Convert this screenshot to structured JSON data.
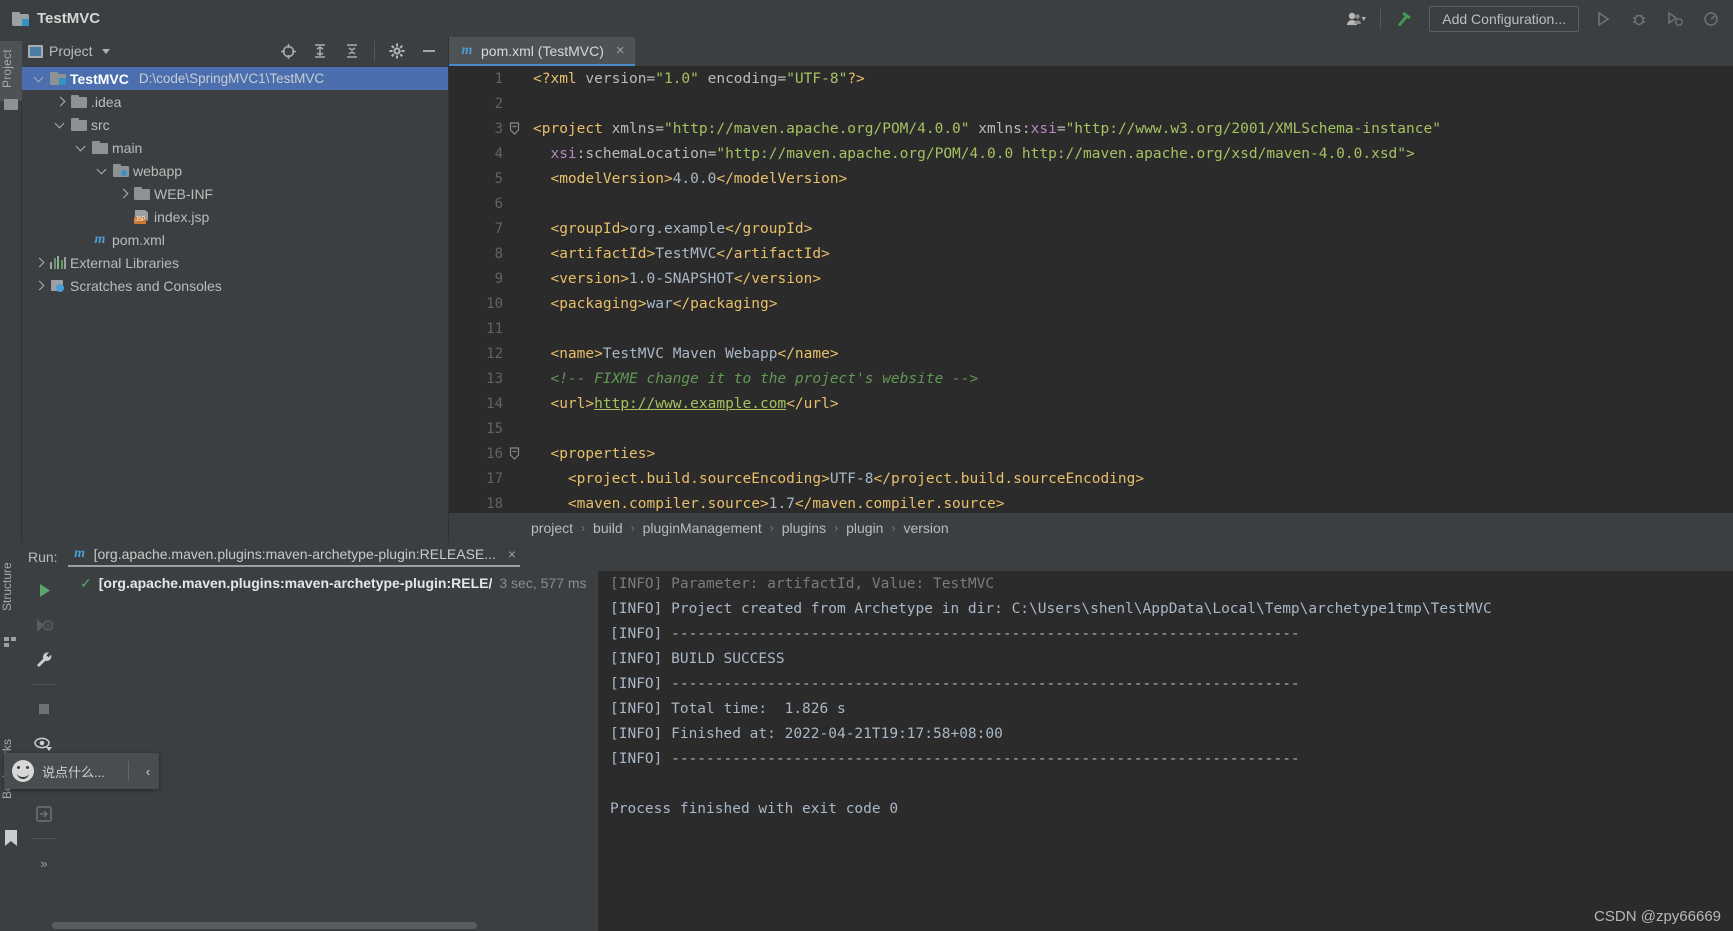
{
  "window": {
    "title": "TestMVC",
    "project_icon": "folder-module-icon"
  },
  "titlebar": {
    "user_icon": "user-account-icon",
    "hammer_icon": "build-hammer-icon",
    "add_configuration": "Add Configuration...",
    "run_icon": "run-icon",
    "debug_icon": "debug-icon",
    "coverage_icon": "run-with-coverage-icon",
    "profile_icon": "profiler-icon"
  },
  "left_strip": {
    "project_tab": "Project",
    "structure_tab": "Structure",
    "bookmarks_tab": "Bookmarks"
  },
  "project_panel": {
    "title": "Project",
    "icons": {
      "locate": "locate-file-icon",
      "expand": "expand-all-icon",
      "collapse": "collapse-all-icon",
      "settings": "gear-icon",
      "hide": "hide-panel-icon",
      "dropdown": "chevron-down-icon"
    },
    "tree": [
      {
        "label": "TestMVC",
        "path": "D:\\code\\SpringMVC1\\TestMVC",
        "indent": 0,
        "icon": "module-folder-icon",
        "state": "expanded",
        "selected": true,
        "bold": true
      },
      {
        "label": ".idea",
        "path": "",
        "indent": 1,
        "icon": "folder-icon",
        "state": "collapsed",
        "selected": false,
        "bold": false
      },
      {
        "label": "src",
        "path": "",
        "indent": 1,
        "icon": "folder-icon",
        "state": "expanded",
        "selected": false,
        "bold": false
      },
      {
        "label": "main",
        "path": "",
        "indent": 2,
        "icon": "folder-icon",
        "state": "expanded",
        "selected": false,
        "bold": false
      },
      {
        "label": "webapp",
        "path": "",
        "indent": 3,
        "icon": "web-folder-icon",
        "state": "expanded",
        "selected": false,
        "bold": false
      },
      {
        "label": "WEB-INF",
        "path": "",
        "indent": 4,
        "icon": "folder-icon",
        "state": "collapsed",
        "selected": false,
        "bold": false
      },
      {
        "label": "index.jsp",
        "path": "",
        "indent": 4,
        "icon": "jsp-file-icon",
        "state": "leaf",
        "selected": false,
        "bold": false
      },
      {
        "label": "pom.xml",
        "path": "",
        "indent": 2,
        "icon": "maven-file-icon",
        "state": "leaf",
        "selected": false,
        "bold": false
      },
      {
        "label": "External Libraries",
        "path": "",
        "indent": 0,
        "icon": "libraries-icon",
        "state": "collapsed",
        "selected": false,
        "bold": false
      },
      {
        "label": "Scratches and Consoles",
        "path": "",
        "indent": 0,
        "icon": "scratches-icon",
        "state": "collapsed",
        "selected": false,
        "bold": false
      }
    ]
  },
  "editor": {
    "tab": {
      "label": "pom.xml (TestMVC)",
      "icon": "maven-file-icon",
      "close": "×"
    },
    "lines": [
      {
        "n": "1",
        "fold": false,
        "tokens": [
          {
            "t": "tag",
            "v": "<?xml "
          },
          {
            "t": "attr",
            "v": "version="
          },
          {
            "t": "val",
            "v": "\"1.0\""
          },
          {
            "t": "attr",
            "v": " encoding="
          },
          {
            "t": "val",
            "v": "\"UTF-8\""
          },
          {
            "t": "tag",
            "v": "?>"
          }
        ]
      },
      {
        "n": "2",
        "fold": false,
        "tokens": []
      },
      {
        "n": "3",
        "fold": true,
        "tokens": [
          {
            "t": "tag",
            "v": "<project "
          },
          {
            "t": "attr",
            "v": "xmlns="
          },
          {
            "t": "val",
            "v": "\"http://maven.apache.org/POM/4.0.0\""
          },
          {
            "t": "attr",
            "v": " xmlns:"
          },
          {
            "t": "ns",
            "v": "xsi"
          },
          {
            "t": "attr",
            "v": "="
          },
          {
            "t": "val",
            "v": "\"http://www.w3.org/2001/XMLSchema-instance\""
          }
        ]
      },
      {
        "n": "4",
        "fold": false,
        "tokens": [
          {
            "t": "txt",
            "v": "  "
          },
          {
            "t": "ns",
            "v": "xsi"
          },
          {
            "t": "attr",
            "v": ":schemaLocation="
          },
          {
            "t": "val",
            "v": "\"http://maven.apache.org/POM/4.0.0 http://maven.apache.org/xsd/maven-4.0.0.xsd\">"
          }
        ]
      },
      {
        "n": "5",
        "fold": false,
        "tokens": [
          {
            "t": "txt",
            "v": "  "
          },
          {
            "t": "tag",
            "v": "<modelVersion>"
          },
          {
            "t": "txt",
            "v": "4.0.0"
          },
          {
            "t": "tag",
            "v": "</modelVersion>"
          }
        ]
      },
      {
        "n": "6",
        "fold": false,
        "tokens": []
      },
      {
        "n": "7",
        "fold": false,
        "tokens": [
          {
            "t": "txt",
            "v": "  "
          },
          {
            "t": "tag",
            "v": "<groupId>"
          },
          {
            "t": "txt",
            "v": "org.example"
          },
          {
            "t": "tag",
            "v": "</groupId>"
          }
        ]
      },
      {
        "n": "8",
        "fold": false,
        "tokens": [
          {
            "t": "txt",
            "v": "  "
          },
          {
            "t": "tag",
            "v": "<artifactId>"
          },
          {
            "t": "txt",
            "v": "TestMVC"
          },
          {
            "t": "tag",
            "v": "</artifactId>"
          }
        ]
      },
      {
        "n": "9",
        "fold": false,
        "tokens": [
          {
            "t": "txt",
            "v": "  "
          },
          {
            "t": "tag",
            "v": "<version>"
          },
          {
            "t": "txt",
            "v": "1.0-SNAPSHOT"
          },
          {
            "t": "tag",
            "v": "</version>"
          }
        ]
      },
      {
        "n": "10",
        "fold": false,
        "tokens": [
          {
            "t": "txt",
            "v": "  "
          },
          {
            "t": "tag",
            "v": "<packaging>"
          },
          {
            "t": "txt",
            "v": "war"
          },
          {
            "t": "tag",
            "v": "</packaging>"
          }
        ]
      },
      {
        "n": "11",
        "fold": false,
        "tokens": []
      },
      {
        "n": "12",
        "fold": false,
        "tokens": [
          {
            "t": "txt",
            "v": "  "
          },
          {
            "t": "tag",
            "v": "<name>"
          },
          {
            "t": "txt",
            "v": "TestMVC Maven Webapp"
          },
          {
            "t": "tag",
            "v": "</name>"
          }
        ]
      },
      {
        "n": "13",
        "fold": false,
        "tokens": [
          {
            "t": "txt",
            "v": "  "
          },
          {
            "t": "com",
            "v": "<!-- FIXME change it to the project's website -->"
          }
        ]
      },
      {
        "n": "14",
        "fold": false,
        "tokens": [
          {
            "t": "txt",
            "v": "  "
          },
          {
            "t": "tag",
            "v": "<url>"
          },
          {
            "t": "lnk",
            "v": "http://www.example.com"
          },
          {
            "t": "tag",
            "v": "</url>"
          }
        ]
      },
      {
        "n": "15",
        "fold": false,
        "tokens": []
      },
      {
        "n": "16",
        "fold": true,
        "tokens": [
          {
            "t": "txt",
            "v": "  "
          },
          {
            "t": "tag",
            "v": "<properties>"
          }
        ]
      },
      {
        "n": "17",
        "fold": false,
        "tokens": [
          {
            "t": "txt",
            "v": "    "
          },
          {
            "t": "tag",
            "v": "<project.build.sourceEncoding>"
          },
          {
            "t": "txt",
            "v": "UTF-8"
          },
          {
            "t": "tag",
            "v": "</project.build.sourceEncoding>"
          }
        ]
      },
      {
        "n": "18",
        "fold": false,
        "tokens": [
          {
            "t": "txt",
            "v": "    "
          },
          {
            "t": "tag",
            "v": "<maven.compiler.source>"
          },
          {
            "t": "txt",
            "v": "1.7"
          },
          {
            "t": "tag",
            "v": "</maven.compiler.source>"
          }
        ]
      }
    ],
    "breadcrumbs": [
      "project",
      "build",
      "pluginManagement",
      "plugins",
      "plugin",
      "version"
    ],
    "breadcrumb_separator": "›"
  },
  "run_panel": {
    "label": "Run:",
    "tab_icon": "maven-file-icon",
    "tab_title": "[org.apache.maven.plugins:maven-archetype-plugin:RELEASE...",
    "tab_close": "×",
    "side_icons": [
      "rerun-icon",
      "rerun-failed-icon",
      "settings-wrench-icon",
      "stop-icon",
      "eye-filter-icon",
      "camera-snapshot-icon",
      "export-icon",
      "more-icon"
    ],
    "tree": [
      {
        "status_icon": "check-icon",
        "name": "[org.apache.maven.plugins:maven-archetype-plugin:RELE/",
        "duration": "3 sec, 577 ms"
      }
    ],
    "console": [
      {
        "text": "[INFO] Parameter: artifactId, Value: TestMVC",
        "dim": true
      },
      {
        "text": "[INFO] Project created from Archetype in dir: C:\\Users\\shenl\\AppData\\Local\\Temp\\archetype1tmp\\TestMVC",
        "dim": false
      },
      {
        "text": "[INFO] ------------------------------------------------------------------------",
        "dim": false
      },
      {
        "text": "[INFO] BUILD SUCCESS",
        "dim": false
      },
      {
        "text": "[INFO] ------------------------------------------------------------------------",
        "dim": false
      },
      {
        "text": "[INFO] Total time:  1.826 s",
        "dim": false
      },
      {
        "text": "[INFO] Finished at: 2022-04-21T19:17:58+08:00",
        "dim": false
      },
      {
        "text": "[INFO] ------------------------------------------------------------------------",
        "dim": false
      },
      {
        "text": "",
        "dim": false
      },
      {
        "text": "Process finished with exit code 0",
        "dim": false
      }
    ]
  },
  "chat_widget": {
    "placeholder": "说点什么...",
    "collapse": "‹",
    "avatar_icon": "smiley-face-icon"
  },
  "watermark": "CSDN @zpy66669",
  "colors": {
    "accent_blue": "#4b6eaf",
    "tab_underline": "#4a88c7",
    "success_green": "#59a869",
    "editor_bg": "#2b2b2b",
    "panel_bg": "#3c3f41"
  }
}
